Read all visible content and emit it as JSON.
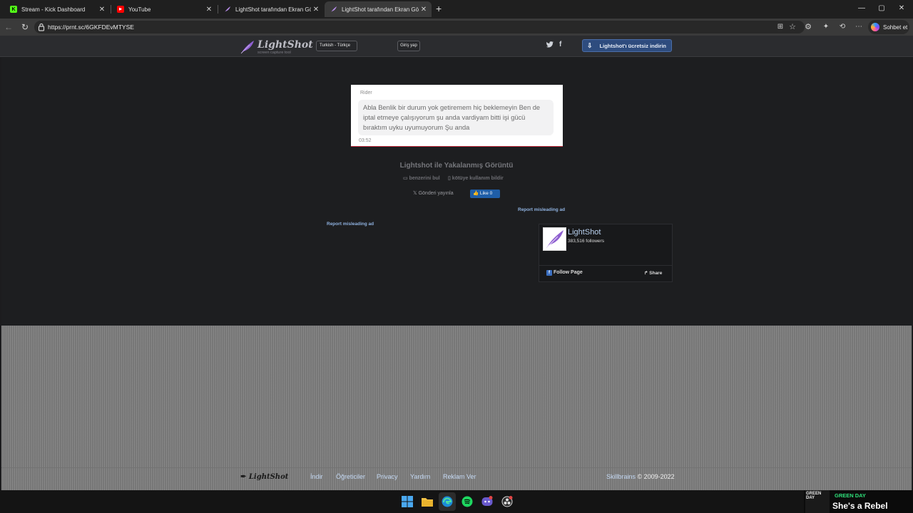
{
  "browser": {
    "tabs": [
      {
        "label": "Stream - Kick Dashboard",
        "close": "✕"
      },
      {
        "label": "YouTube",
        "close": "✕"
      },
      {
        "label": "LightShot tarafından Ekran Görünt",
        "close": "✕"
      },
      {
        "label": "LightShot tarafından Ekran Görünt",
        "close": "✕"
      }
    ],
    "new_tab": "+",
    "window_controls": {
      "minimize": "—",
      "maximize": "▢",
      "close": "✕"
    },
    "url": "https://prnt.sc/6GKFDEvMTYSE",
    "copilot_label": "Sohbet et"
  },
  "header": {
    "logo_text": "LightShot",
    "logo_sub": "screen capture tool",
    "language": "Turkish - Türkçe",
    "login": "Giriş yap",
    "download": "Lightshot'ı ücretsiz indirin"
  },
  "screenshot": {
    "author": "Rider",
    "message": "Abla Benlik bir durum yok getiremem hiç beklemeyin Ben de iptal etmeye çalışıyorum şu anda vardiyam bitti işi gücü bıraktım uyku uyumuyorum Şu anda",
    "time": "03:52"
  },
  "page": {
    "caption": "Lightshot ile Yakalanmış Görüntü",
    "find_similar": "benzerini bul",
    "report_abuse": "kötüye kullanım bildir",
    "post": "Gönderi yayınla",
    "like": "Like 0",
    "report_ad_right": "Report misleading ad",
    "report_ad_left": "Report misleading ad"
  },
  "fb_widget": {
    "name": "LightShot",
    "followers": "383,516 followers",
    "follow": "Follow Page",
    "share": "Share"
  },
  "footer": {
    "logo": "LightShot",
    "links": [
      "İndir",
      "Öğreticiler",
      "Privacy",
      "Yardım",
      "Reklam Ver"
    ],
    "company": "Skillbrains",
    "copyright": " © 2009-2022"
  },
  "now_playing": {
    "art_text": "GREEN DAY",
    "artist": "GREEN DAY",
    "title": "She's a Rebel"
  },
  "colors": {
    "page_bg": "#1d1e20",
    "header_bg": "#2b2c2f",
    "download_btn": "#2e4c7e",
    "link": "#8fb2e0",
    "spotify_green": "#2fe07a"
  }
}
